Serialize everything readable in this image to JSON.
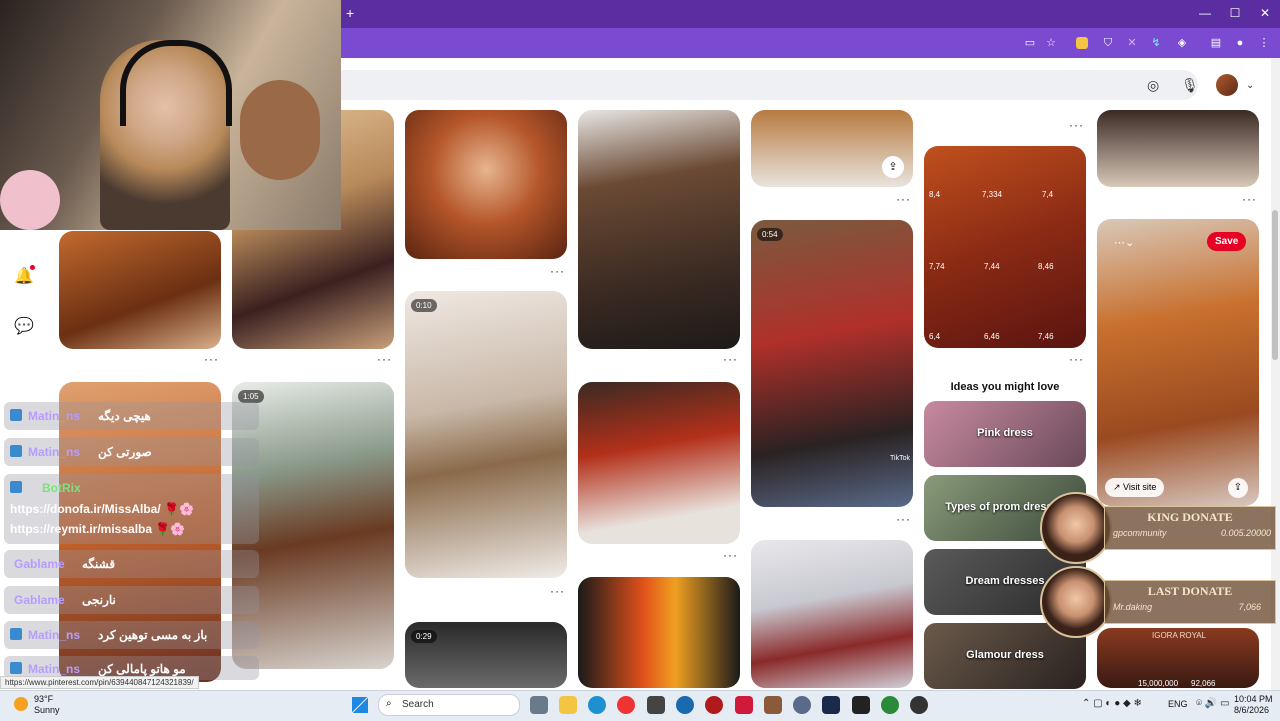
{
  "browser": {
    "new_tab": "+",
    "window_controls": [
      "—",
      "☐",
      "✕"
    ],
    "toolbar_icons": [
      "cast-icon",
      "star-icon",
      "extension-icon",
      "shield-icon",
      "extension-icon",
      "extension-icon",
      "puzzle-icon",
      "sidebar-icon",
      "profile-icon",
      "menu-icon"
    ]
  },
  "search": {
    "icons": [
      "lens-icon",
      "mic-icon"
    ]
  },
  "rail": {
    "icons": [
      "home-icon",
      "bell-icon",
      "chat-icon",
      "settings-icon"
    ]
  },
  "pins": {
    "badges": [
      "0:54",
      "0:10",
      "1:05",
      "0:29"
    ],
    "chart_values": [
      "8,4",
      "7,334",
      "7,4",
      "7,74",
      "7,44",
      "8,46",
      "6,4",
      "6,46",
      "7,46"
    ],
    "save_label": "Save",
    "visit_label": "Visit site",
    "tiktok_label": "TikTok"
  },
  "ideas": {
    "heading": "Ideas you might love",
    "items": [
      "Pink dress",
      "Types of prom dresses",
      "Dream dresses",
      "Glamour dress"
    ]
  },
  "chat": {
    "messages": [
      {
        "user": "Matin_ns",
        "text": "هیچی دیگه"
      },
      {
        "user": "Matin_ns",
        "text": "صورتی کن"
      },
      {
        "user": "BotRix",
        "text": "https://donofa.ir/MissAlba/ 🌹🌸"
      },
      {
        "user": "",
        "text": "https://reymit.ir/missalba 🌹🌸"
      },
      {
        "user": "Gablame",
        "text": "قشنگه"
      },
      {
        "user": "Gablame",
        "text": "نارنجی"
      },
      {
        "user": "Matin_ns",
        "text": "باز به مسی توهین کرد"
      },
      {
        "user": "Matin_ns",
        "text": "مو هاتو پامالی کن"
      }
    ]
  },
  "donate": {
    "king_title": "KING DONATE",
    "king_user": "gpcommunity",
    "king_amount": "0.005.20000",
    "last_title": "LAST DONATE",
    "last_user": "Mr.daking",
    "last_amount": "7,066",
    "footer_brand": "IGORA ROYAL",
    "footer_count": "92,066",
    "footer_amount": "15,000,000"
  },
  "status_url": "https://www.pinterest.com/pin/639440847124321839/",
  "taskbar": {
    "weather_temp": "93°F",
    "weather_desc": "Sunny",
    "search_label": "Search",
    "lang": "ENG",
    "time": "10:04 PM",
    "date": "8/6/2026"
  }
}
